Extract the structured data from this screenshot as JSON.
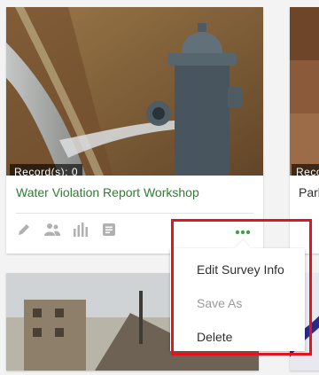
{
  "main_card": {
    "record_badge": "Record(s): 0",
    "title": "Water Violation Report Workshop",
    "actions": [
      "pencil-icon",
      "people-icon",
      "bar-chart-icon",
      "document-icon"
    ],
    "more_icon": "more-dots-icon"
  },
  "side_card": {
    "record_badge": "Reco",
    "title": "Park"
  },
  "menu": {
    "items": [
      {
        "label": "Edit Survey Info",
        "enabled": true
      },
      {
        "label": "Save As",
        "enabled": false
      },
      {
        "label": "Delete",
        "enabled": true
      }
    ]
  },
  "colors": {
    "title_green": "#2e7d32",
    "more_dots_green": "#43a047",
    "highlight_red": "#e4141e",
    "icon_gray": "#b0b0b0"
  }
}
